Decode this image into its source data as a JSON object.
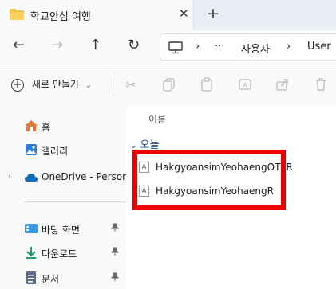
{
  "tab": {
    "title": "학교안심 여행",
    "close": "✕",
    "new_tab": "+"
  },
  "nav": {
    "back": "←",
    "forward": "→",
    "up": "↑",
    "refresh": "↻"
  },
  "address": {
    "more": "···",
    "sep1": "›",
    "sep2": "›",
    "crumb_1": "사용자",
    "crumb_2": "User"
  },
  "toolbar": {
    "new_label": "새로 만들기",
    "chevron": "⌄"
  },
  "sidebar": {
    "items": [
      {
        "label": "홈"
      },
      {
        "label": "갤러리"
      },
      {
        "label": "OneDrive - Persona"
      },
      {
        "label": "바탕 화면",
        "pin": "📌"
      },
      {
        "label": "다운로드",
        "pin": "📌"
      },
      {
        "label": "문서",
        "pin": "📌"
      }
    ],
    "expander": "›"
  },
  "content": {
    "column_name": "이름",
    "group_label": "오늘",
    "group_chevron": "⌄",
    "files": [
      {
        "name": "HakgyoansimYeohaengOTFR",
        "icon_text": "A"
      },
      {
        "name": "HakgyoansimYeohaengR",
        "icon_text": "A"
      }
    ]
  },
  "colors": {
    "highlight": "#ee0000",
    "folder": "#f5c342",
    "onedrive": "#0f6cbd",
    "download": "#1a9e6e"
  }
}
